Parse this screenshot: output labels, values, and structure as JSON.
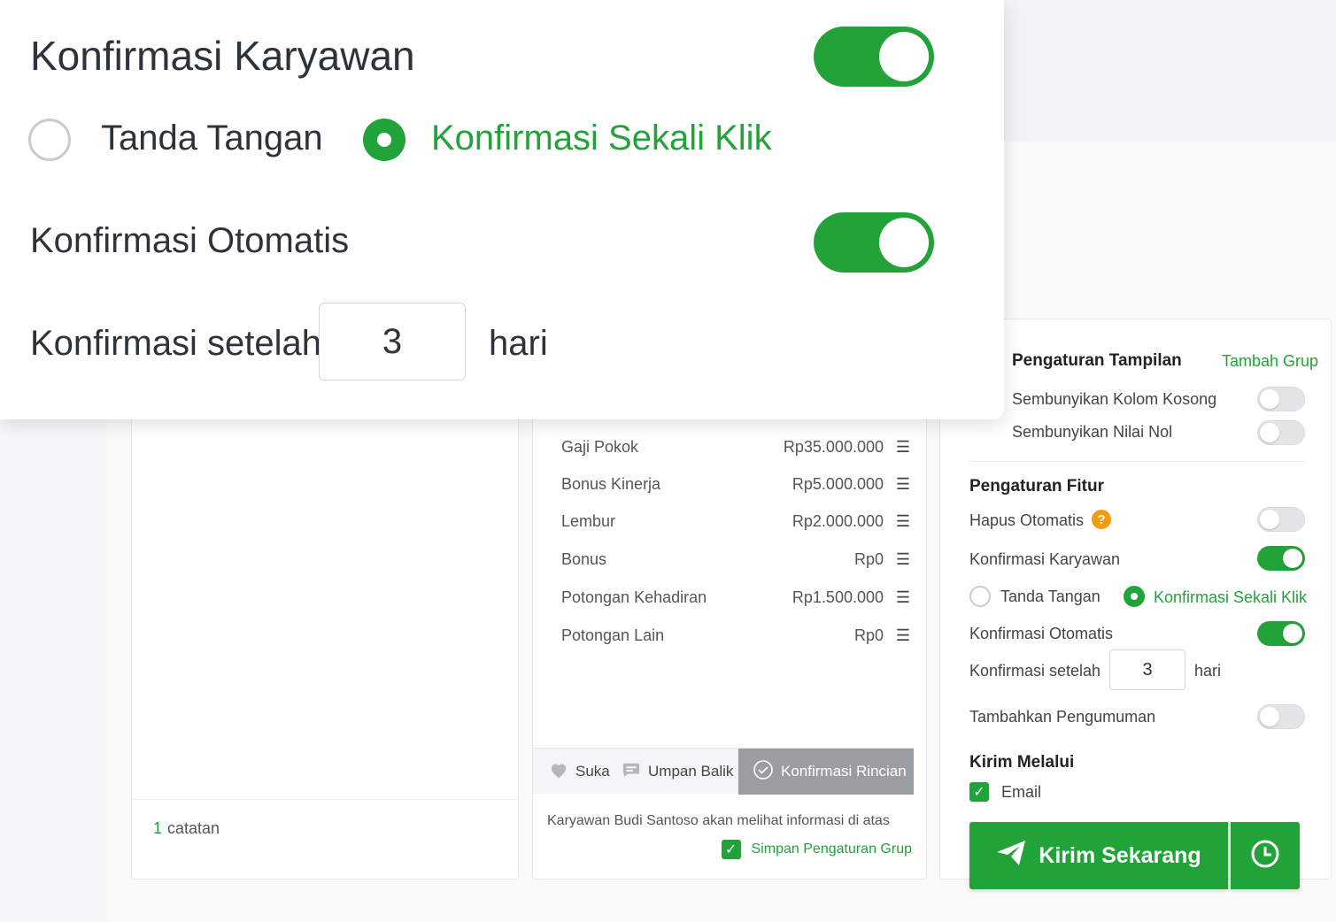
{
  "zoom": {
    "title": "Konfirmasi Karyawan",
    "radio_signature": "Tanda Tangan",
    "radio_one_click": "Konfirmasi Sekali Klik",
    "auto_confirm": "Konfirmasi Otomatis",
    "confirm_after": "Konfirmasi setelah",
    "days_value": "3",
    "days_unit": "hari"
  },
  "left_card": {
    "record_count": "1",
    "record_label": "catatan"
  },
  "salary": {
    "rows": [
      {
        "label": "Gaji Pokok",
        "value": "Rp35.000.000"
      },
      {
        "label": "Bonus Kinerja",
        "value": "Rp5.000.000"
      },
      {
        "label": "Lembur",
        "value": "Rp2.000.000"
      },
      {
        "label": "Bonus",
        "value": "Rp0"
      },
      {
        "label": "Potongan Kehadiran",
        "value": "Rp1.500.000"
      },
      {
        "label": "Potongan Lain",
        "value": "Rp0"
      }
    ],
    "actions": {
      "like": "Suka",
      "feedback": "Umpan Balik",
      "confirm_details": "Konfirmasi Rincian"
    },
    "notice": "Karyawan Budi Santoso akan melihat informasi di atas",
    "save_group": "Simpan Pengaturan Grup"
  },
  "settings": {
    "display_title": "Pengaturan Tampilan",
    "add_group": "Tambah Grup",
    "hide_empty_columns": "Sembunyikan Kolom Kosong",
    "hide_zero_values": "Sembunyikan Nilai Nol",
    "feature_title": "Pengaturan Fitur",
    "auto_delete": "Hapus Otomatis",
    "employee_confirm": "Konfirmasi Karyawan",
    "radio_signature": "Tanda Tangan",
    "radio_one_click": "Konfirmasi Sekali Klik",
    "auto_confirm": "Konfirmasi Otomatis",
    "confirm_after": "Konfirmasi setelah",
    "days_value": "3",
    "days_unit": "hari",
    "add_announcement": "Tambahkan Pengumuman",
    "send_via_title": "Kirim Melalui",
    "email": "Email",
    "send_now": "Kirim Sekarang"
  },
  "colors": {
    "accent": "#22a33a",
    "warning": "#f39c12"
  }
}
